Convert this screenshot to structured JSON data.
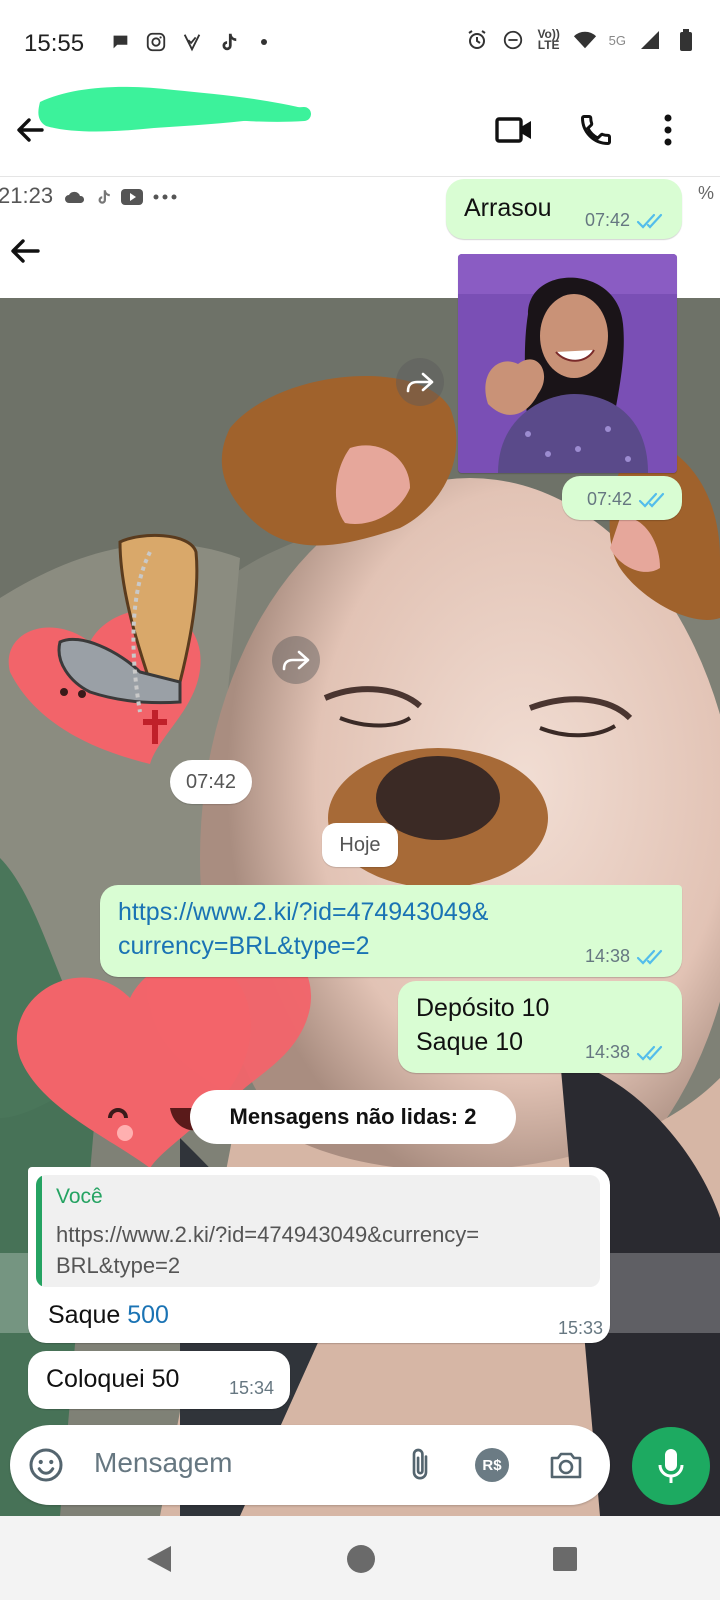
{
  "status_bar": {
    "time": "15:55",
    "network_label": "Vo)) LTE",
    "network_gen": "5G",
    "left_icons": [
      "chat-bubble-icon",
      "instagram-icon",
      "vpn-check-icon",
      "tiktok-icon",
      "dot-icon"
    ],
    "right_icons": [
      "alarm-icon",
      "do-not-disturb-icon",
      "wifi-icon",
      "signal-icon",
      "battery-icon"
    ]
  },
  "header": {
    "contact_name_redacted": true,
    "actions": [
      "video-call",
      "voice-call",
      "more-options"
    ]
  },
  "wallpaper": {
    "status_time": "21:23",
    "percent_fragment": "%"
  },
  "messages": {
    "m1": {
      "text": "Arrasou",
      "time": "07:42",
      "direction": "out",
      "status": "read"
    },
    "m2": {
      "type": "image",
      "time": "07:42",
      "direction": "out",
      "status": "read"
    },
    "m3": {
      "type": "sticker",
      "time": "07:42",
      "direction": "in"
    },
    "day_separator": "Hoje",
    "m4": {
      "text": "https://www.2.ki/?id=474943049&currency=BRL&type=2",
      "line1": "https://www.2.ki/?id=474943049&",
      "line2": "currency=BRL&type=2",
      "time": "14:38",
      "direction": "out",
      "status": "read"
    },
    "m5": {
      "line1": "Depósito 10",
      "line2": "Saque 10",
      "time": "14:38",
      "direction": "out",
      "status": "read"
    },
    "unread_label": "Mensagens não lidas: 2",
    "m6": {
      "quote_author": "Você",
      "quote_line1": "https://www.2.ki/?id=474943049&currency=",
      "quote_line2": "BRL&type=2",
      "text_prefix": "Saque",
      "text_number": "500",
      "time": "15:33",
      "direction": "in"
    },
    "m7": {
      "text": "Coloquei 50",
      "time": "15:34",
      "direction": "in"
    }
  },
  "input": {
    "placeholder": "Mensagem",
    "payment_label": "R$"
  },
  "colors": {
    "outgoing_bubble": "#d9fdd3",
    "incoming_bubble": "#ffffff",
    "read_ticks": "#53bdeb",
    "accent_green": "#1daa61",
    "quote_green": "#25a362",
    "link_blue": "#1a73b4"
  }
}
